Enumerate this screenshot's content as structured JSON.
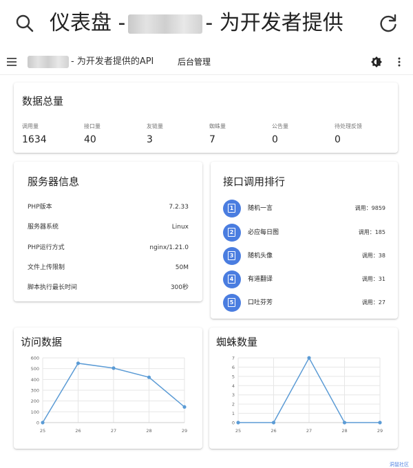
{
  "browser": {
    "title_prefix": "仪表盘 -",
    "title_suffix": "- 为开发者提供"
  },
  "appbar": {
    "brand_suffix": "- 为开发者提供的API",
    "admin_label": "后台管理"
  },
  "stats": {
    "title": "数据总量",
    "items": [
      {
        "label": "调用量",
        "value": "1634"
      },
      {
        "label": "接口量",
        "value": "40"
      },
      {
        "label": "友链量",
        "value": "3"
      },
      {
        "label": "蜘蛛量",
        "value": "7"
      },
      {
        "label": "公告量",
        "value": "0"
      },
      {
        "label": "待处理反馈",
        "value": "0"
      }
    ]
  },
  "server": {
    "title": "服务器信息",
    "rows": [
      {
        "key": "PHP版本",
        "value": "7.2.33"
      },
      {
        "key": "服务器系统",
        "value": "Linux"
      },
      {
        "key": "PHP运行方式",
        "value": "nginx/1.21.0"
      },
      {
        "key": "文件上传限制",
        "value": "50M"
      },
      {
        "key": "脚本执行最长时间",
        "value": "300秒"
      }
    ]
  },
  "ranking": {
    "title": "接口调用排行",
    "items": [
      {
        "rank": "1",
        "name": "随机一言",
        "count": "调用：9859"
      },
      {
        "rank": "2",
        "name": "必应每日图",
        "count": "调用：185"
      },
      {
        "rank": "3",
        "name": "随机头像",
        "count": "调用：38"
      },
      {
        "rank": "4",
        "name": "有道翻译",
        "count": "调用：31"
      },
      {
        "rank": "5",
        "name": "口吐芬芳",
        "count": "调用：27"
      }
    ]
  },
  "colors": {
    "accent": "#4a7de0",
    "line": "#5b9bd5"
  },
  "icons": {
    "search": "search-icon",
    "refresh": "refresh-icon",
    "menu": "menu-icon",
    "theme": "theme-toggle-icon",
    "more": "more-vert-icon",
    "rank": "document-icon"
  },
  "chart_data": [
    {
      "type": "line",
      "title": "访问数据",
      "x": [
        "25",
        "26",
        "27",
        "28",
        "29"
      ],
      "series": [
        {
          "values": [
            0,
            550,
            505,
            420,
            145
          ]
        }
      ],
      "yticks": [
        0,
        100,
        200,
        300,
        400,
        500,
        600
      ],
      "ylim": [
        0,
        600
      ],
      "grid": true
    },
    {
      "type": "line",
      "title": "蜘蛛数量",
      "x": [
        "25",
        "26",
        "27",
        "28",
        "29"
      ],
      "series": [
        {
          "values": [
            0,
            0,
            7,
            0,
            0
          ]
        }
      ],
      "yticks": [
        0,
        1,
        2,
        3,
        4,
        5,
        6,
        7
      ],
      "ylim": [
        0,
        7
      ],
      "grid": true
    }
  ],
  "watermark": "洞鼠社区"
}
